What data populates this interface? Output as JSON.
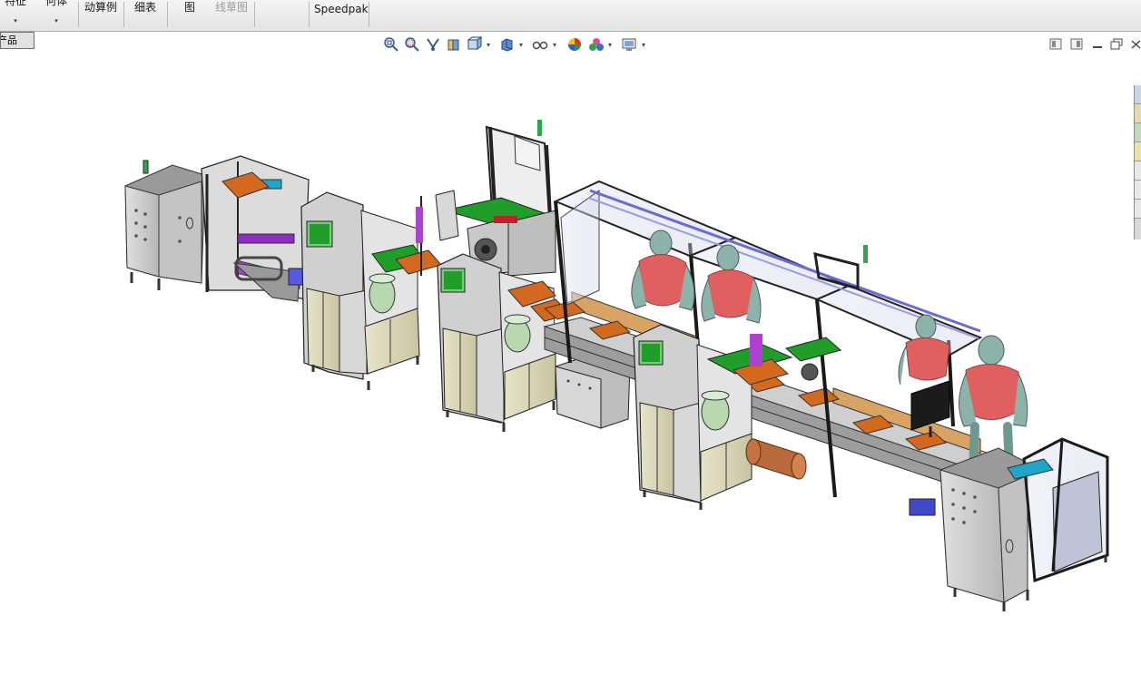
{
  "ribbon": {
    "items": [
      {
        "label": "特征",
        "caret": "▾",
        "disabled": false
      },
      {
        "label": "何体",
        "caret": "▾",
        "disabled": false
      },
      {
        "label": "动算例",
        "caret": "",
        "disabled": false
      },
      {
        "label": "细表",
        "caret": "",
        "disabled": false
      },
      {
        "label": "图",
        "caret": "",
        "disabled": false
      },
      {
        "label": "线草图",
        "caret": "",
        "disabled": true
      },
      {
        "label": "Speedpak",
        "caret": "",
        "disabled": false
      }
    ]
  },
  "tab": {
    "label": "产品"
  },
  "hud": {
    "icons": [
      "zoom-to-fit-icon",
      "zoom-to-area-icon",
      "previous-view-icon",
      "section-view-icon",
      "view-orientation-icon",
      "display-style-icon",
      "hide-show-icon",
      "edit-appearance-icon",
      "apply-scene-icon",
      "view-settings-icon"
    ]
  },
  "window": {
    "buttons": [
      "tile-left-icon",
      "tile-right-icon",
      "minimize-icon",
      "restore-icon",
      "close-icon"
    ]
  },
  "colors": {
    "frame_gray": "#c8c8c8",
    "frame_dark": "#2a2a2a",
    "cabinet_beige": "#d9d6b8",
    "fixture_orange": "#d2691e",
    "pcb_green": "#1f9e2a",
    "mannequin_red": "#e06060",
    "mannequin_teal": "#7fa9a0",
    "cylinder_purple": "#9b30c8",
    "cover_blue": "#6a6ad8"
  }
}
